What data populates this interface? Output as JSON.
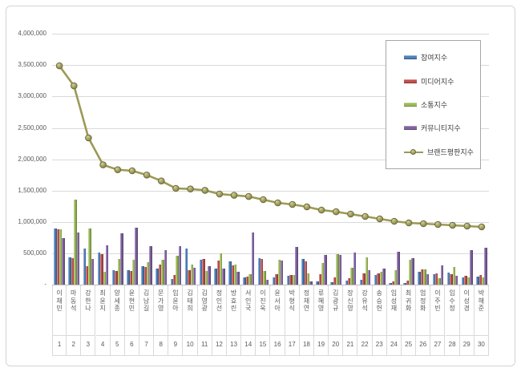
{
  "chart_data": {
    "type": "bar+line",
    "title": "",
    "categories": [
      "이채민",
      "마동석",
      "강한나",
      "최윤지",
      "양세종",
      "윤현민",
      "김남길",
      "문가영",
      "임윤아",
      "김태희",
      "김영광",
      "정인선",
      "방효린",
      "서인국",
      "이진욱",
      "윤서아",
      "박형식",
      "정채연",
      "류혜영",
      "김광규",
      "장신영",
      "강유석",
      "송승헌",
      "임성재",
      "최귀화",
      "엄정화",
      "이주빈",
      "임수정",
      "이성경",
      "박해준"
    ],
    "ranks": [
      "1",
      "2",
      "3",
      "4",
      "5",
      "6",
      "7",
      "8",
      "9",
      "10",
      "11",
      "12",
      "13",
      "14",
      "15",
      "16",
      "17",
      "18",
      "19",
      "20",
      "21",
      "22",
      "23",
      "24",
      "25",
      "26",
      "27",
      "28",
      "29",
      "30"
    ],
    "series": [
      {
        "name": "참여지수",
        "type": "bar",
        "color": "#4f81bd",
        "values": [
          890000,
          435000,
          578000,
          509000,
          226000,
          226000,
          296000,
          250000,
          95000,
          580000,
          395000,
          256000,
          375000,
          110000,
          427000,
          115000,
          140000,
          405000,
          50000,
          40000,
          60000,
          75000,
          155000,
          20000,
          30000,
          210000,
          170000,
          195000,
          120000,
          130000
        ]
      },
      {
        "name": "미디어지수",
        "type": "bar",
        "color": "#c0504d",
        "values": [
          880000,
          426000,
          296000,
          487000,
          213000,
          213000,
          283000,
          325000,
          152000,
          230000,
          405000,
          378000,
          305000,
          134000,
          415000,
          170000,
          148000,
          375000,
          165000,
          115000,
          100000,
          185000,
          180000,
          55000,
          65000,
          240000,
          185000,
          165000,
          135000,
          150000
        ]
      },
      {
        "name": "소통지수",
        "type": "bar",
        "color": "#9bbb59",
        "values": [
          885000,
          1360000,
          900000,
          204000,
          404000,
          391000,
          357000,
          400000,
          465000,
          315000,
          215000,
          496000,
          325000,
          163000,
          215000,
          400000,
          155000,
          185000,
          350000,
          490000,
          265000,
          430000,
          210000,
          225000,
          395000,
          245000,
          100000,
          285000,
          110000,
          120000
        ]
      },
      {
        "name": "커뮤니티지수",
        "type": "bar",
        "color": "#8064a2",
        "values": [
          740000,
          826000,
          413000,
          630000,
          813000,
          913000,
          617000,
          545000,
          617000,
          270000,
          297000,
          252000,
          205000,
          825000,
          80000,
          385000,
          600000,
          45000,
          470000,
          475000,
          515000,
          225000,
          250000,
          525000,
          420000,
          160000,
          305000,
          135000,
          555000,
          590000
        ]
      },
      {
        "name": "브랜드평판지수",
        "type": "line",
        "color": "#9c9a55",
        "values": [
          3490000,
          3170000,
          2340000,
          1910000,
          1833000,
          1816000,
          1748000,
          1654000,
          1534000,
          1526000,
          1504000,
          1445000,
          1425000,
          1406000,
          1355000,
          1304000,
          1279000,
          1240000,
          1189000,
          1163000,
          1125000,
          1087000,
          1048000,
          1010000,
          985000,
          972000,
          959000,
          946000,
          934000,
          921000
        ]
      }
    ],
    "y_axis": {
      "min": 0,
      "max": 4150000,
      "tick_interval": 500000,
      "tick_labels": [
        "4,000,000",
        "3,500,000",
        "3,000,000",
        "2,500,000",
        "2,000,000",
        "1,500,000",
        "1,000,000",
        "500,000",
        "-"
      ]
    },
    "legend_position": "upper-right",
    "grid": true
  },
  "legend": {
    "items": [
      {
        "label": "참여지수"
      },
      {
        "label": "미디어지수"
      },
      {
        "label": "소통지수"
      },
      {
        "label": "커뮤니티지수"
      },
      {
        "label": "브랜드평판지수"
      }
    ]
  }
}
